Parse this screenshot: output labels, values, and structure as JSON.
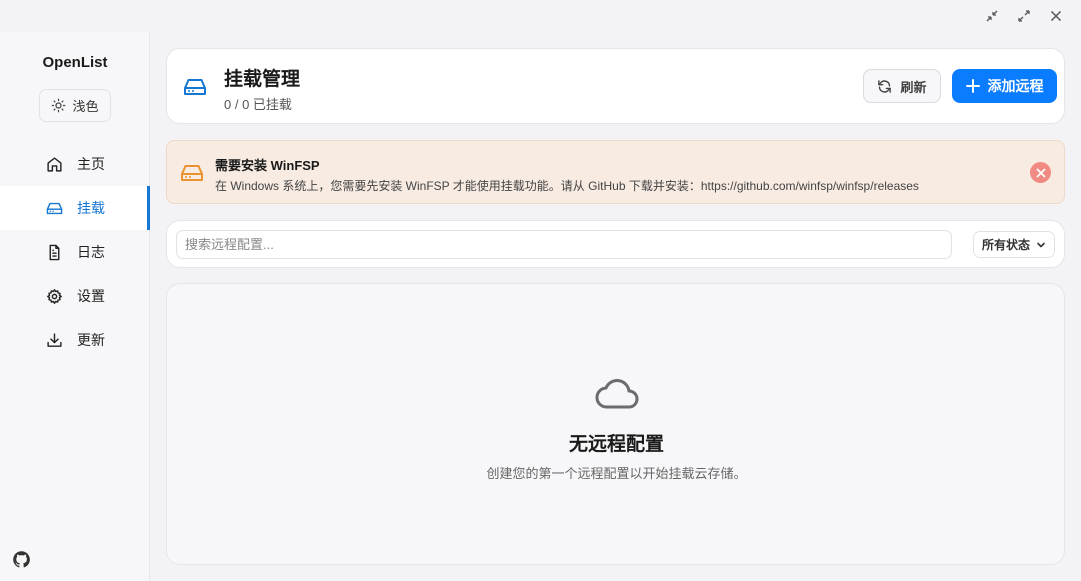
{
  "window": {
    "controls": [
      "minimize-icon",
      "maximize-icon",
      "close-icon"
    ]
  },
  "sidebar": {
    "app_title": "OpenList",
    "theme_label": "浅色",
    "items": [
      {
        "label": "主页",
        "icon": "home-icon"
      },
      {
        "label": "挂载",
        "icon": "drive-icon",
        "active": true
      },
      {
        "label": "日志",
        "icon": "document-icon"
      },
      {
        "label": "设置",
        "icon": "gear-icon"
      },
      {
        "label": "更新",
        "icon": "download-icon"
      }
    ],
    "footer_icon": "github-icon"
  },
  "header": {
    "title": "挂载管理",
    "count": "0 / 0 已挂载",
    "refresh_label": "刷新",
    "add_label": "添加远程"
  },
  "warning": {
    "title": "需要安装 WinFSP",
    "text": "在 Windows 系统上，您需要先安装 WinFSP 才能使用挂载功能。请从 GitHub 下载并安装：https://github.com/winfsp/winfsp/releases"
  },
  "search": {
    "placeholder": "搜索远程配置...",
    "value": "",
    "status_selected": "所有状态"
  },
  "empty": {
    "title": "无远程配置",
    "description": "创建您的第一个远程配置以开始挂载云存储。"
  },
  "colors": {
    "accent": "#1677d2",
    "primary_button": "#0a7cff",
    "warning_bg": "#f7ebe2",
    "warning_icon": "#e8932f",
    "close_badge": "#f08a82"
  }
}
